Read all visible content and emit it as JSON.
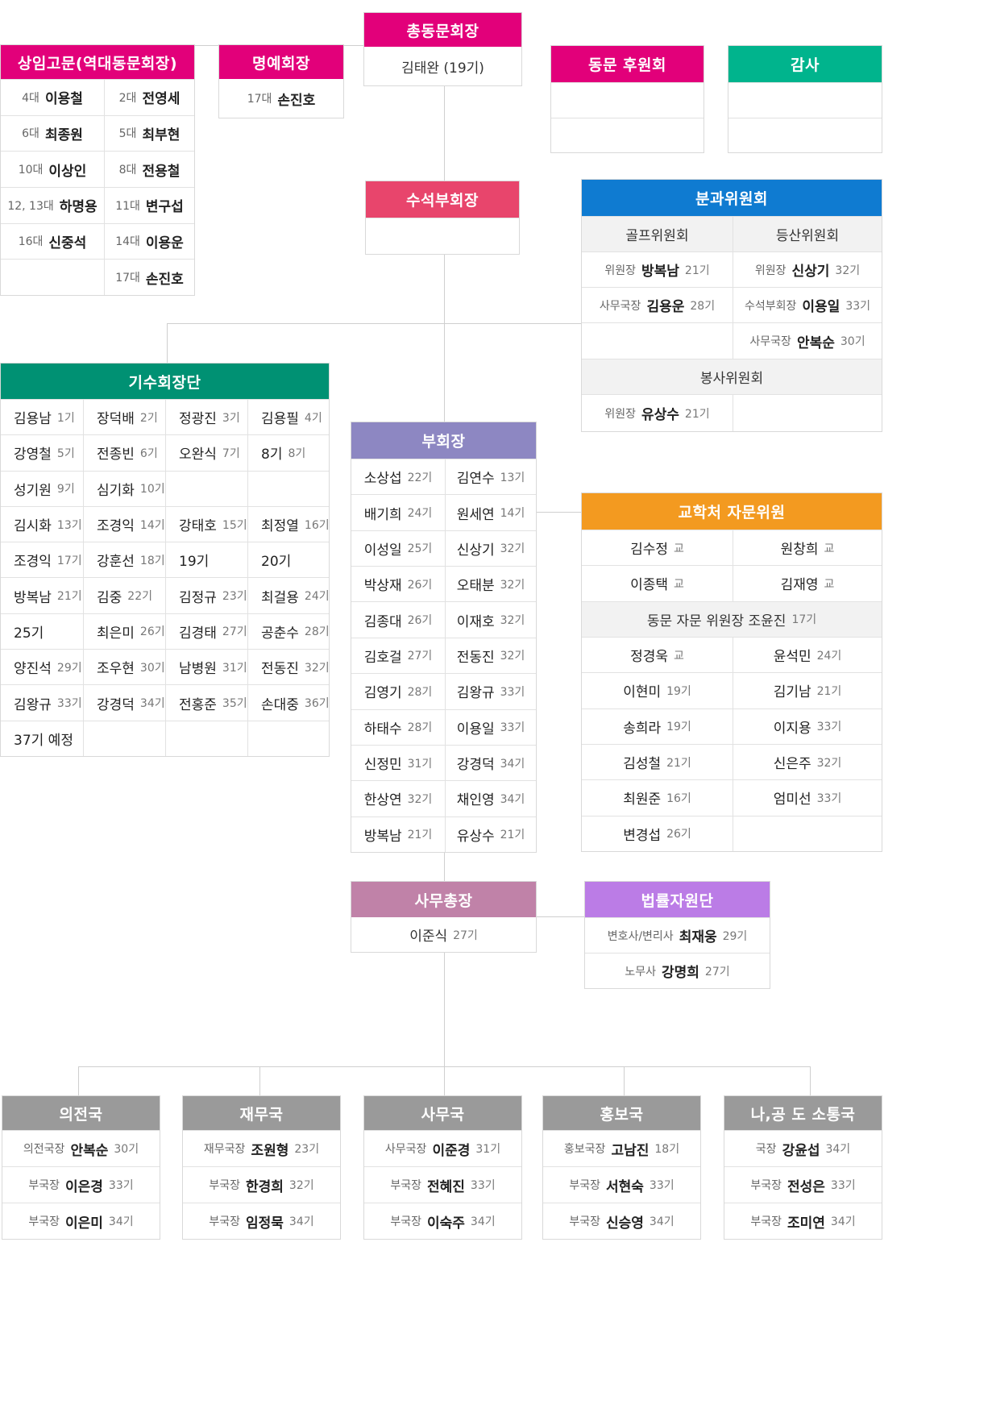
{
  "colors": {
    "magenta": "#e2007a",
    "teal": "#00b48d",
    "red": "#e8456c",
    "blue": "#0f7bd1",
    "green": "#009173",
    "purple": "#8d87c2",
    "orange": "#f39a20",
    "mauve": "#c082a8",
    "violet": "#bb7ce6",
    "gray": "#9a9a9a"
  },
  "president": {
    "title": "총동문회장",
    "value": "김태완 (19기)"
  },
  "advisers": {
    "title": "상임고문(역대동문회장)",
    "rows": [
      [
        {
          "pre": "4대",
          "name": "이용철"
        },
        {
          "pre": "2대",
          "name": "전영세"
        }
      ],
      [
        {
          "pre": "6대",
          "name": "최종원"
        },
        {
          "pre": "5대",
          "name": "최부현"
        }
      ],
      [
        {
          "pre": "10대",
          "name": "이상인"
        },
        {
          "pre": "8대",
          "name": "전용철"
        }
      ],
      [
        {
          "pre": "12, 13대",
          "name": "하명용"
        },
        {
          "pre": "11대",
          "name": "변구섭"
        }
      ],
      [
        {
          "pre": "16대",
          "name": "신중석"
        },
        {
          "pre": "14대",
          "name": "이용운"
        }
      ],
      [
        {
          "pre": "",
          "name": ""
        },
        {
          "pre": "17대",
          "name": "손진호"
        }
      ]
    ]
  },
  "honorary": {
    "title": "명예회장",
    "pre": "17대",
    "name": "손진호"
  },
  "supporters": {
    "title": "동문 후원회"
  },
  "audit": {
    "title": "감사"
  },
  "senior_vp": {
    "title": "수석부회장"
  },
  "committees": {
    "title": "분과위원회",
    "golf": "골프위원회",
    "hiking": "등산위원회",
    "rows": [
      [
        {
          "pre": "위원장",
          "name": "방복남",
          "suf": "21기"
        },
        {
          "pre": "위원장",
          "name": "신상기",
          "suf": "32기"
        }
      ],
      [
        {
          "pre": "사무국장",
          "name": "김용운",
          "suf": "28기"
        },
        {
          "pre": "수석부회장",
          "name": "이용일",
          "suf": "33기"
        }
      ],
      [
        {
          "pre": "",
          "name": "",
          "suf": ""
        },
        {
          "pre": "사무국장",
          "name": "안복순",
          "suf": "30기"
        }
      ]
    ],
    "service": "봉사위원회",
    "service_row": [
      {
        "pre": "위원장",
        "name": "유상수",
        "suf": "21기"
      },
      {
        "pre": "",
        "name": "",
        "suf": ""
      }
    ]
  },
  "class_presidents": {
    "title": "기수회장단",
    "rows": [
      [
        {
          "name": "김용남",
          "suf": "1기"
        },
        {
          "name": "장덕배",
          "suf": "2기"
        },
        {
          "name": "정광진",
          "suf": "3기"
        },
        {
          "name": "김용필",
          "suf": "4기"
        }
      ],
      [
        {
          "name": "강영철",
          "suf": "5기"
        },
        {
          "name": "전종빈",
          "suf": "6기"
        },
        {
          "name": "오완식",
          "suf": "7기"
        },
        {
          "name": "8기",
          "suf": "8기"
        }
      ],
      [
        {
          "name": "성기원",
          "suf": "9기"
        },
        {
          "name": "심기화",
          "suf": "10기"
        },
        {
          "name": "",
          "suf": ""
        },
        {
          "name": "",
          "suf": ""
        }
      ],
      [
        {
          "name": "김시화",
          "suf": "13기"
        },
        {
          "name": "조경익",
          "suf": "14기"
        },
        {
          "name": "강태호",
          "suf": "15기"
        },
        {
          "name": "최정열",
          "suf": "16기"
        }
      ],
      [
        {
          "name": "조경익",
          "suf": "17기"
        },
        {
          "name": "강훈선",
          "suf": "18기"
        },
        {
          "name": "19기",
          "suf": ""
        },
        {
          "name": "20기",
          "suf": ""
        }
      ],
      [
        {
          "name": "방복남",
          "suf": "21기"
        },
        {
          "name": "김중",
          "suf": "22기"
        },
        {
          "name": "김정규",
          "suf": "23기"
        },
        {
          "name": "최걸용",
          "suf": "24기"
        }
      ],
      [
        {
          "name": "25기",
          "suf": ""
        },
        {
          "name": "최은미",
          "suf": "26기"
        },
        {
          "name": "김경태",
          "suf": "27기"
        },
        {
          "name": "공춘수",
          "suf": "28기"
        }
      ],
      [
        {
          "name": "양진석",
          "suf": "29기"
        },
        {
          "name": "조우현",
          "suf": "30기"
        },
        {
          "name": "남병원",
          "suf": "31기"
        },
        {
          "name": "전동진",
          "suf": "32기"
        }
      ],
      [
        {
          "name": "김왕규",
          "suf": "33기"
        },
        {
          "name": "강경덕",
          "suf": "34기"
        },
        {
          "name": "전홍준",
          "suf": "35기"
        },
        {
          "name": "손대중",
          "suf": "36기"
        }
      ],
      [
        {
          "name": "37기 예정",
          "suf": ""
        },
        {
          "name": "",
          "suf": ""
        },
        {
          "name": "",
          "suf": ""
        },
        {
          "name": "",
          "suf": ""
        }
      ]
    ]
  },
  "vice_presidents": {
    "title": "부회장",
    "rows": [
      [
        {
          "name": "소상섭",
          "suf": "22기"
        },
        {
          "name": "김연수",
          "suf": "13기"
        }
      ],
      [
        {
          "name": "배기희",
          "suf": "24기"
        },
        {
          "name": "원세연",
          "suf": "14기"
        }
      ],
      [
        {
          "name": "이성일",
          "suf": "25기"
        },
        {
          "name": "신상기",
          "suf": "32기"
        }
      ],
      [
        {
          "name": "박상재",
          "suf": "26기"
        },
        {
          "name": "오태분",
          "suf": "32기"
        }
      ],
      [
        {
          "name": "김종대",
          "suf": "26기"
        },
        {
          "name": "이재호",
          "suf": "32기"
        }
      ],
      [
        {
          "name": "김호걸",
          "suf": "27기"
        },
        {
          "name": "전동진",
          "suf": "32기"
        }
      ],
      [
        {
          "name": "김영기",
          "suf": "28기"
        },
        {
          "name": "김왕규",
          "suf": "33기"
        }
      ],
      [
        {
          "name": "하태수",
          "suf": "28기"
        },
        {
          "name": "이용일",
          "suf": "33기"
        }
      ],
      [
        {
          "name": "신정민",
          "suf": "31기"
        },
        {
          "name": "강경덕",
          "suf": "34기"
        }
      ],
      [
        {
          "name": "한상연",
          "suf": "32기"
        },
        {
          "name": "채인영",
          "suf": "34기"
        }
      ],
      [
        {
          "name": "방복남",
          "suf": "21기"
        },
        {
          "name": "유상수",
          "suf": "21기"
        }
      ]
    ]
  },
  "advisory": {
    "title": "교학처 자문위원",
    "rows": [
      [
        {
          "name": "김수정",
          "suf": "교"
        },
        {
          "name": "원창희",
          "suf": "교"
        }
      ],
      [
        {
          "name": "이종택",
          "suf": "교"
        },
        {
          "name": "김재영",
          "suf": "교"
        }
      ]
    ],
    "chair": "동문 자문 위원장 조윤진",
    "chair_suf": "17기",
    "rows2": [
      [
        {
          "name": "정경욱",
          "suf": "교"
        },
        {
          "name": "윤석민",
          "suf": "24기"
        }
      ],
      [
        {
          "name": "이현미",
          "suf": "19기"
        },
        {
          "name": "김기남",
          "suf": "21기"
        }
      ],
      [
        {
          "name": "송희라",
          "suf": "19기"
        },
        {
          "name": "이지용",
          "suf": "33기"
        }
      ],
      [
        {
          "name": "김성철",
          "suf": "21기"
        },
        {
          "name": "신은주",
          "suf": "32기"
        }
      ],
      [
        {
          "name": "최원준",
          "suf": "16기"
        },
        {
          "name": "엄미선",
          "suf": "33기"
        }
      ],
      [
        {
          "name": "변경섭",
          "suf": "26기"
        },
        {
          "name": "",
          "suf": ""
        }
      ]
    ]
  },
  "secretary_general": {
    "title": "사무총장",
    "name": "이준식",
    "suf": "27기"
  },
  "legal": {
    "title": "법률자원단",
    "rows": [
      {
        "pre": "변호사/변리사",
        "name": "최재웅",
        "suf": "29기"
      },
      {
        "pre": "노무사",
        "name": "강명희",
        "suf": "27기"
      }
    ]
  },
  "bureaus": [
    {
      "title": "의전국",
      "rows": [
        {
          "pre": "의전국장",
          "name": "안복순",
          "suf": "30기"
        },
        {
          "pre": "부국장",
          "name": "이은경",
          "suf": "33기"
        },
        {
          "pre": "부국장",
          "name": "이은미",
          "suf": "34기"
        }
      ]
    },
    {
      "title": "재무국",
      "rows": [
        {
          "pre": "재무국장",
          "name": "조원형",
          "suf": "23기"
        },
        {
          "pre": "부국장",
          "name": "한경희",
          "suf": "32기"
        },
        {
          "pre": "부국장",
          "name": "임정묵",
          "suf": "34기"
        }
      ]
    },
    {
      "title": "사무국",
      "rows": [
        {
          "pre": "사무국장",
          "name": "이준경",
          "suf": "31기"
        },
        {
          "pre": "부국장",
          "name": "전혜진",
          "suf": "33기"
        },
        {
          "pre": "부국장",
          "name": "이숙주",
          "suf": "34기"
        }
      ]
    },
    {
      "title": "홍보국",
      "rows": [
        {
          "pre": "홍보국장",
          "name": "고남진",
          "suf": "18기"
        },
        {
          "pre": "부국장",
          "name": "서현숙",
          "suf": "33기"
        },
        {
          "pre": "부국장",
          "name": "신승영",
          "suf": "34기"
        }
      ]
    },
    {
      "title": "나,공 도 소통국",
      "rows": [
        {
          "pre": "국장",
          "name": "강윤섭",
          "suf": "34기"
        },
        {
          "pre": "부국장",
          "name": "전성은",
          "suf": "33기"
        },
        {
          "pre": "부국장",
          "name": "조미연",
          "suf": "34기"
        }
      ]
    }
  ]
}
